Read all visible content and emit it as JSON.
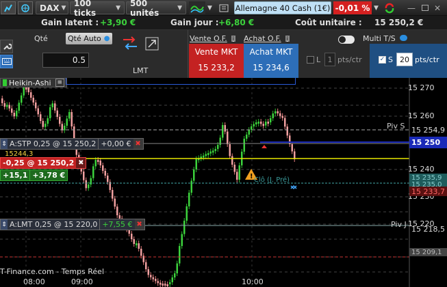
{
  "toolbar": {
    "product": "DAX",
    "period": "100 ticks",
    "quantity": "500 unités",
    "instrument": "Allemagne 40 Cash (1€)",
    "change": "-0,01 %"
  },
  "info": {
    "latent_label": "Gain latent :",
    "latent_value": "+3,90 €",
    "day_label": "Gain jour :",
    "day_value": "+6,80 €",
    "cost_label": "Coût unitaire :",
    "cost_value": "15 250,2 €"
  },
  "panel": {
    "qty_label": "Qté",
    "qty_auto": "Qté Auto",
    "qty_value": "0.5",
    "lmt": "LMT",
    "sell_of": "Vente O.F.",
    "buy_of": "Achat O.F.",
    "multi": "Multi T/S",
    "sell_mkt": "Vente MKT",
    "sell_price": "15 233,2",
    "buy_mkt": "Achat MKT",
    "buy_price": "15 234,6",
    "l_label": "L",
    "l_value": "1",
    "l_unit": "pts/ctr",
    "s_label": "S",
    "s_value": "20",
    "s_unit": "pts/ctr"
  },
  "chart": {
    "style": "Heikin-Ashi",
    "source": "T-Finance.com - Temps Réel",
    "stp_order": "A:STP  0,25 @ 15 250,2",
    "stp_pl": "+0,00 €",
    "pos_order": "-0,25 @ 15 250,2",
    "pos_pts": "+15,1",
    "pos_eur": "+3,78 €",
    "lmt_order": "A:LMT  0,25 @ 15 220,0",
    "lmt_pl": "+7,55 €",
    "pivot_s": "Piv S",
    "pivot_j": "Piv J",
    "pre": "Clô (J. Pré)",
    "small_price": "15244,3",
    "y_ticks": [
      "15 270",
      "15 260",
      "15 240",
      "15 230",
      "15 220"
    ],
    "y_markers": [
      "15 254,9",
      "15 250",
      "15 235,9",
      "15 235,0",
      "15 233,7",
      "15 218,5",
      "15 209,1"
    ],
    "x_ticks": [
      "08:00",
      "09:00",
      "10:00"
    ]
  }
}
